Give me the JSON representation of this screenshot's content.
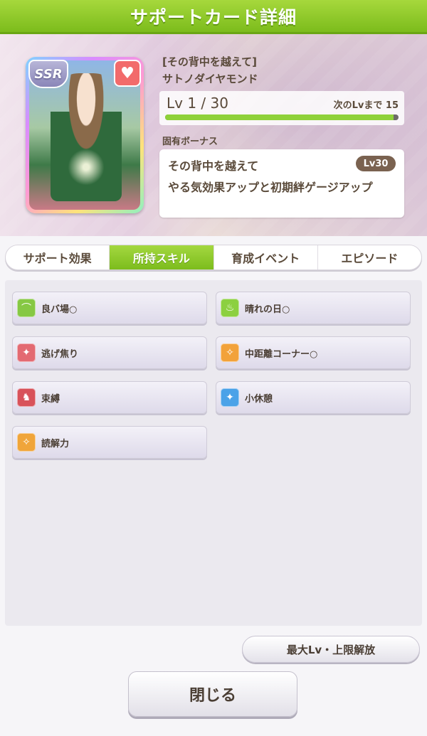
{
  "header": {
    "title": "サポートカード詳細"
  },
  "card": {
    "rarity": "SSR",
    "title": "[その背中を越えて]",
    "name": "サトノダイヤモンド",
    "level_text": "Lv 1 / 30",
    "next_level_text": "次のLvまで 15",
    "level_progress": 0.98,
    "favorite_icon": "heart-icon"
  },
  "bonus": {
    "label": "固有ボーナス",
    "name": "その背中を越えて",
    "level": "Lv30",
    "description": "やる気効果アップと初期絆ゲージアップ"
  },
  "tabs": [
    {
      "label": "サポート効果",
      "active": false
    },
    {
      "label": "所持スキル",
      "active": true
    },
    {
      "label": "育成イベント",
      "active": false
    },
    {
      "label": "エピソード",
      "active": false
    }
  ],
  "skills": [
    {
      "label": "良バ場○",
      "icon": "track-icon",
      "color": "#86c844"
    },
    {
      "label": "晴れの日○",
      "icon": "sun-flame-icon",
      "color": "#8cd040"
    },
    {
      "label": "逃げ焦り",
      "icon": "sparkle-icon",
      "color": "#e36a72"
    },
    {
      "label": "中距離コーナー○",
      "icon": "runner-icon",
      "color": "#f2a23a"
    },
    {
      "label": "束縛",
      "icon": "horse-icon",
      "color": "#d8525a"
    },
    {
      "label": "小休憩",
      "icon": "sparkle-icon",
      "color": "#4aa2e8"
    },
    {
      "label": "読解力",
      "icon": "runner-icon",
      "color": "#f0a53a"
    }
  ],
  "actions": {
    "limit_break": "最大Lv・上限解放",
    "close": "閉じる"
  }
}
